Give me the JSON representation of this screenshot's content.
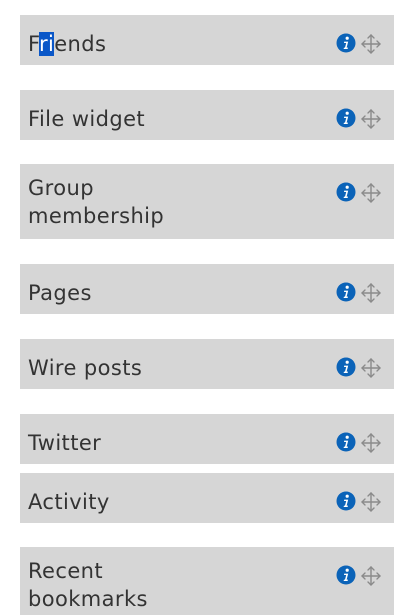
{
  "widgets": [
    {
      "title_pre": "F",
      "title_hl": "ri",
      "title_post": "ends"
    },
    {
      "title": "File widget"
    },
    {
      "title": "Group membership"
    },
    {
      "title": "Pages"
    },
    {
      "title": "Wire posts"
    },
    {
      "title": "Twitter"
    },
    {
      "title": "Activity"
    },
    {
      "title": "Recent bookmarks"
    }
  ],
  "icons": {
    "info": "info-icon",
    "move": "move-icon"
  },
  "colors": {
    "widget_bg": "#d6d6d6",
    "title_text": "#333333",
    "info_icon": "#0b63b8",
    "selection": "#0a57c8"
  }
}
